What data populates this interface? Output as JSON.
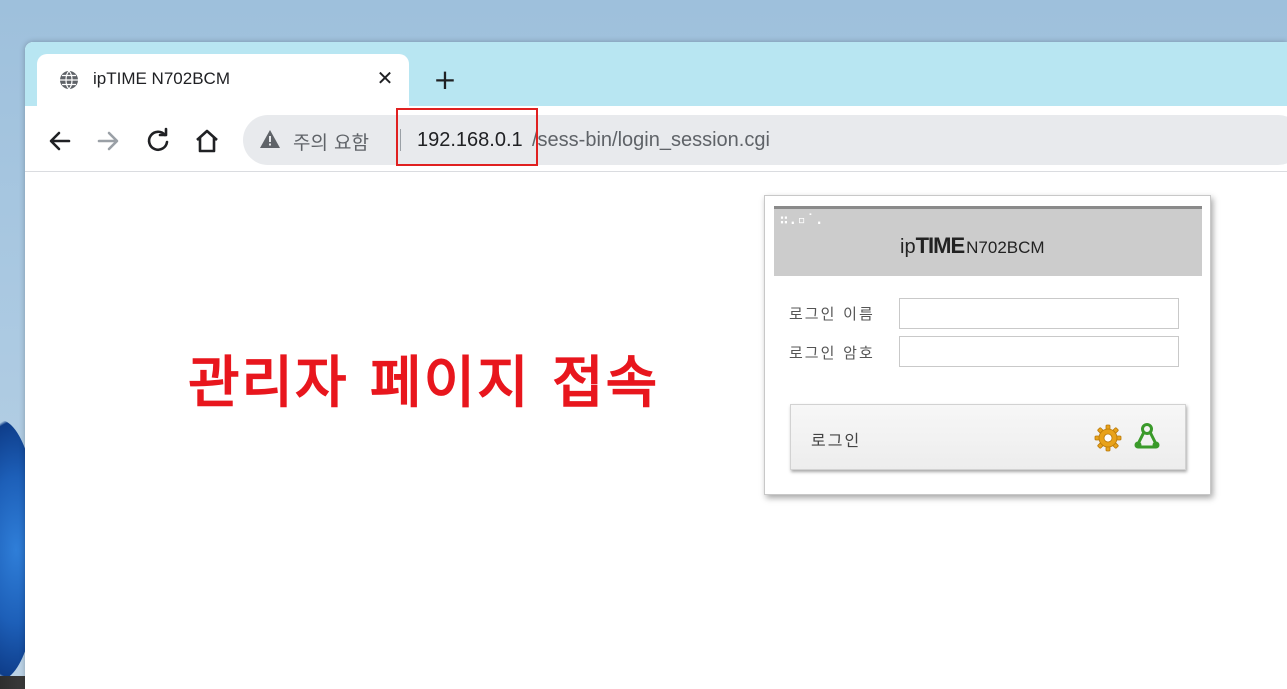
{
  "browser": {
    "tab": {
      "title": "ipTIME N702BCM",
      "favicon": "globe-icon",
      "close_glyph": "✕"
    },
    "new_tab_glyph": "+",
    "toolbar": {
      "back_icon": "back-arrow-icon",
      "forward_icon": "forward-arrow-icon",
      "reload_icon": "reload-icon",
      "home_icon": "home-icon"
    },
    "omnibox": {
      "security_label": "주의 요함",
      "url_host": "192.168.0.1",
      "url_path": "/sess-bin/login_session.cgi"
    }
  },
  "annotation": {
    "text": "관리자 페이지 접속",
    "color": "#e8161d"
  },
  "login_panel": {
    "logo_dots": "∷.▫˙.",
    "brand_ip": "ip",
    "brand_time": "TIME",
    "brand_model": "N702BCM",
    "username_label": "로그인 이름",
    "password_label": "로그인 암호",
    "username_value": "",
    "password_value": "",
    "login_button_label": "로그인",
    "settings_icon": "gear-icon",
    "network_icon": "network-icon"
  },
  "colors": {
    "tabstrip": "#b8e6f2",
    "omnibox": "#e8eaed",
    "highlight": "#e02020",
    "panel_header": "#cccccc"
  }
}
